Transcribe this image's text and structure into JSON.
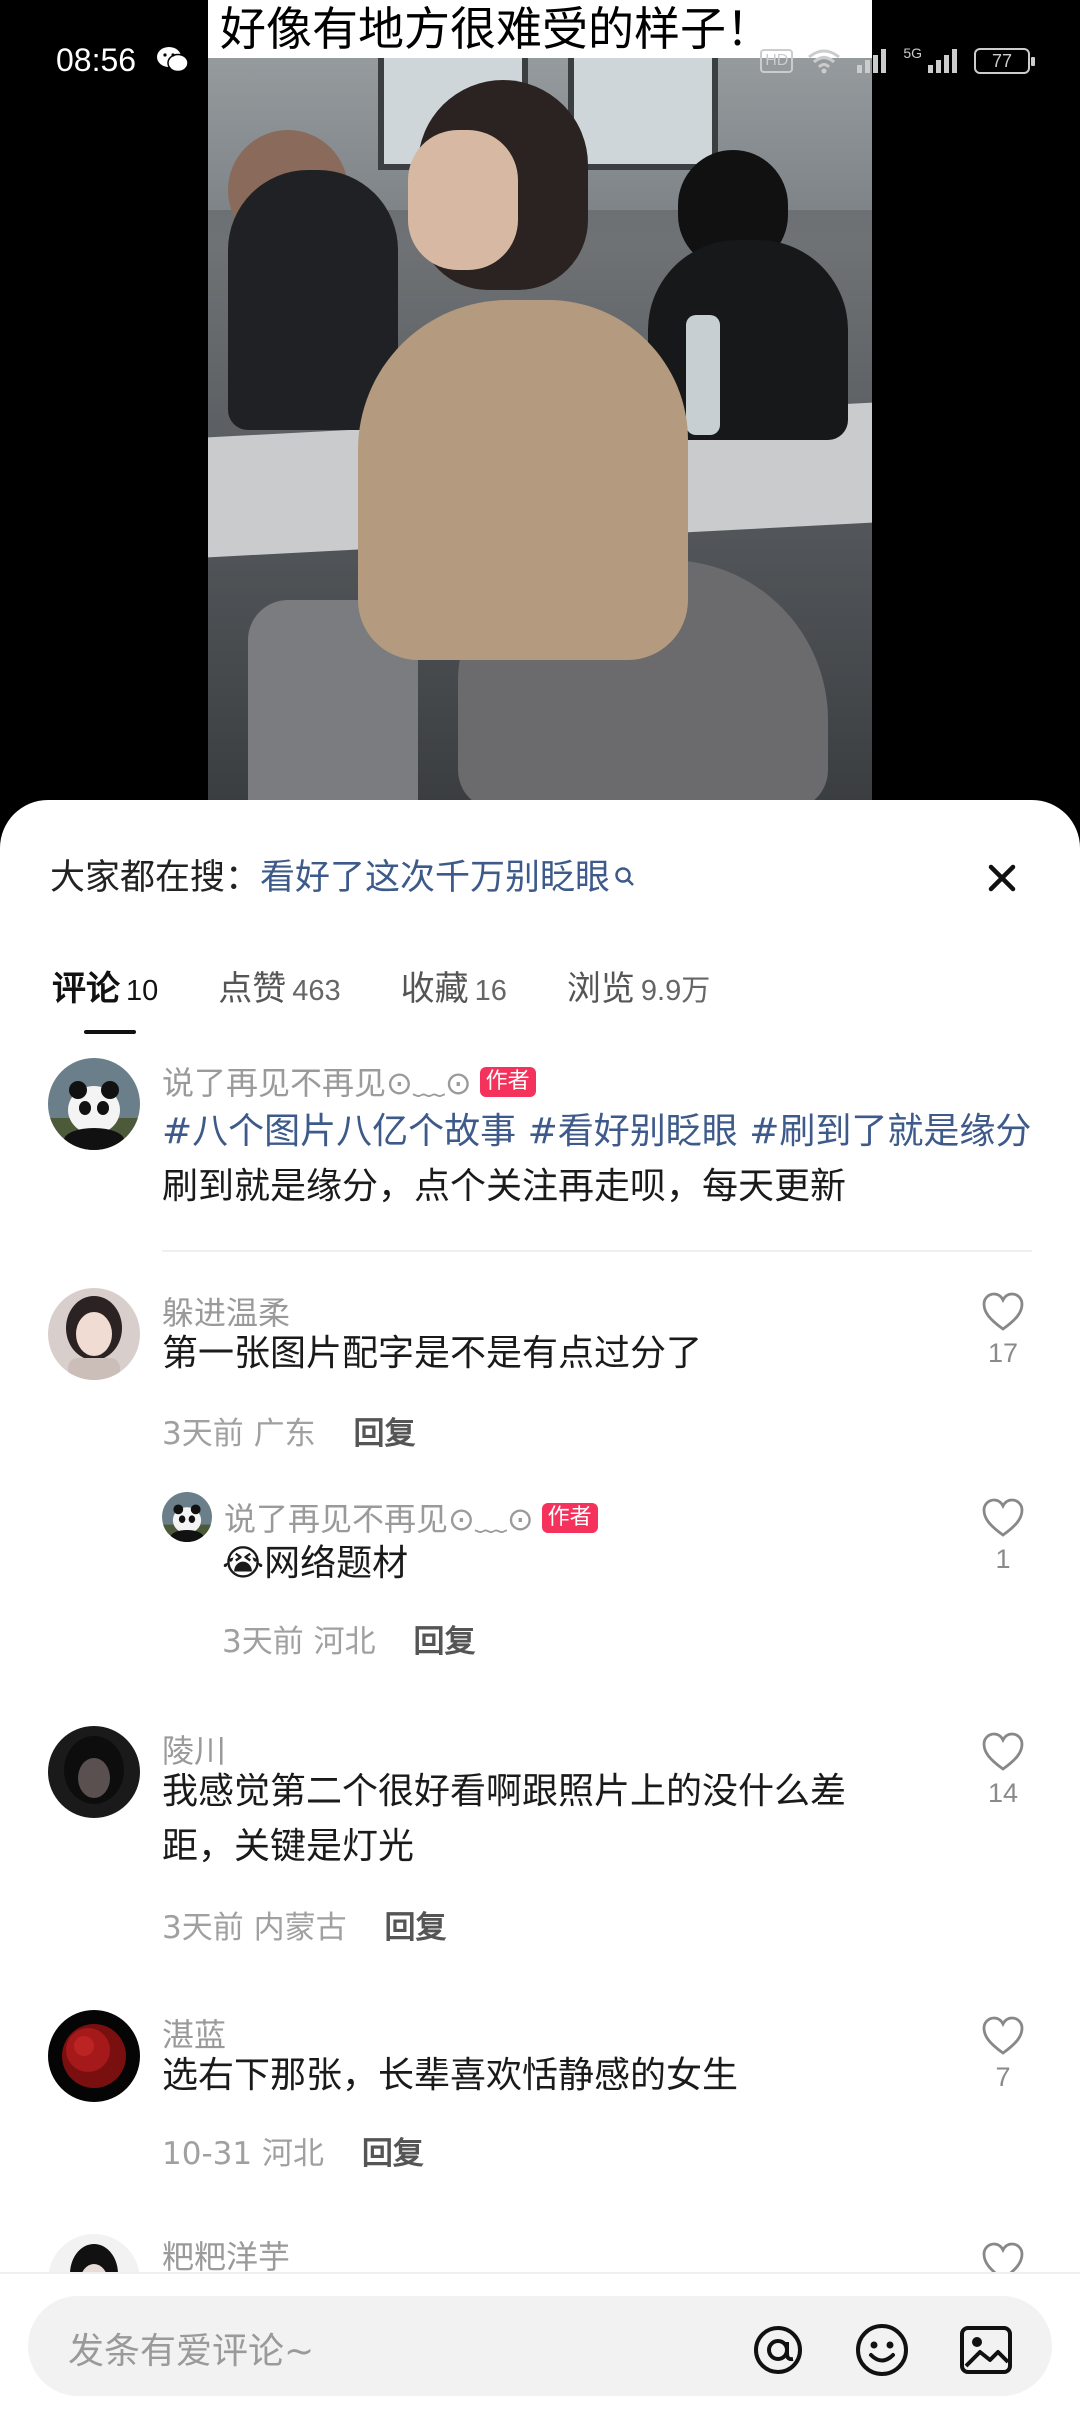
{
  "status": {
    "time": "08:56",
    "hd": "HD",
    "network": "5G",
    "battery": "77"
  },
  "post": {
    "caption": "好像有地方很难受的样子！"
  },
  "sheet": {
    "search_prefix": "大家都在搜：",
    "search_term": "看好了这次千万别眨眼",
    "tabs": [
      {
        "label": "评论",
        "count": "10"
      },
      {
        "label": "点赞",
        "count": "463"
      },
      {
        "label": "收藏",
        "count": "16"
      },
      {
        "label": "浏览",
        "count": "9.9万"
      }
    ],
    "author_badge": "作者",
    "reply_label": "回复",
    "comments": [
      {
        "name": "说了再见不再见⊙﹏⊙",
        "tags": "#八个图片八亿个故事 #看好别眨眼 #刷到了就是缘分",
        "text": "刷到就是缘分，点个关注再走呗，每天更新"
      },
      {
        "name": "躲进温柔",
        "text": "第一张图片配字是不是有点过分了",
        "time": "3天前",
        "location": "广东",
        "likes": "17"
      },
      {
        "name": "说了再见不再见⊙﹏⊙",
        "emoji": "😭",
        "text": "网络题材",
        "time": "3天前",
        "location": "河北",
        "likes": "1"
      },
      {
        "name": "陵川",
        "text_line1": "我感觉第二个很好看啊跟照片上的没什么差",
        "text_line2": "距，关键是灯光",
        "time": "3天前",
        "location": "内蒙古",
        "likes": "14"
      },
      {
        "name": "湛蓝",
        "text": "选右下那张，长辈喜欢恬静感的女生",
        "time": "10-31",
        "location": "河北",
        "likes": "7"
      },
      {
        "name": "粑粑洋芋"
      }
    ],
    "input_placeholder": "发条有爱评论~"
  },
  "colors": {
    "accent_link": "#3d5a8a",
    "author_badge": "#f5325c"
  }
}
